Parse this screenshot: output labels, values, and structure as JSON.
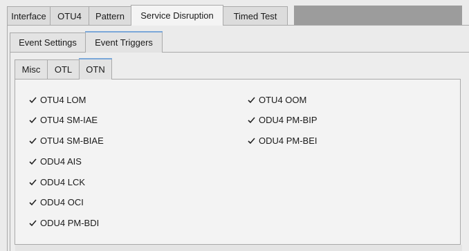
{
  "main_tabs": [
    {
      "label": "Interface"
    },
    {
      "label": "OTU4"
    },
    {
      "label": "Pattern"
    },
    {
      "label": "Service Disruption",
      "active": true
    },
    {
      "label": "Timed Test"
    }
  ],
  "sub_tabs": [
    {
      "label": "Event Settings"
    },
    {
      "label": "Event Triggers",
      "active": true
    }
  ],
  "inner_tabs": [
    {
      "label": "Misc"
    },
    {
      "label": "OTL"
    },
    {
      "label": "OTN",
      "active": true
    }
  ],
  "triggers_left": [
    {
      "label": "OTU4 LOM",
      "checked": true
    },
    {
      "label": "OTU4 SM-IAE",
      "checked": true
    },
    {
      "label": "OTU4 SM-BIAE",
      "checked": true
    },
    {
      "label": "ODU4 AIS",
      "checked": true
    },
    {
      "label": "ODU4 LCK",
      "checked": true
    },
    {
      "label": "ODU4 OCI",
      "checked": true
    },
    {
      "label": "ODU4 PM-BDI",
      "checked": true
    }
  ],
  "triggers_right": [
    {
      "label": "OTU4 OOM",
      "checked": true
    },
    {
      "label": "ODU4 PM-BIP",
      "checked": true
    },
    {
      "label": "ODU4 PM-BEI",
      "checked": true
    }
  ],
  "colors": {
    "accent": "#7aa7d8",
    "tab_bar_fill": "#9c9c9c"
  },
  "icons": {
    "check": "check-icon"
  }
}
